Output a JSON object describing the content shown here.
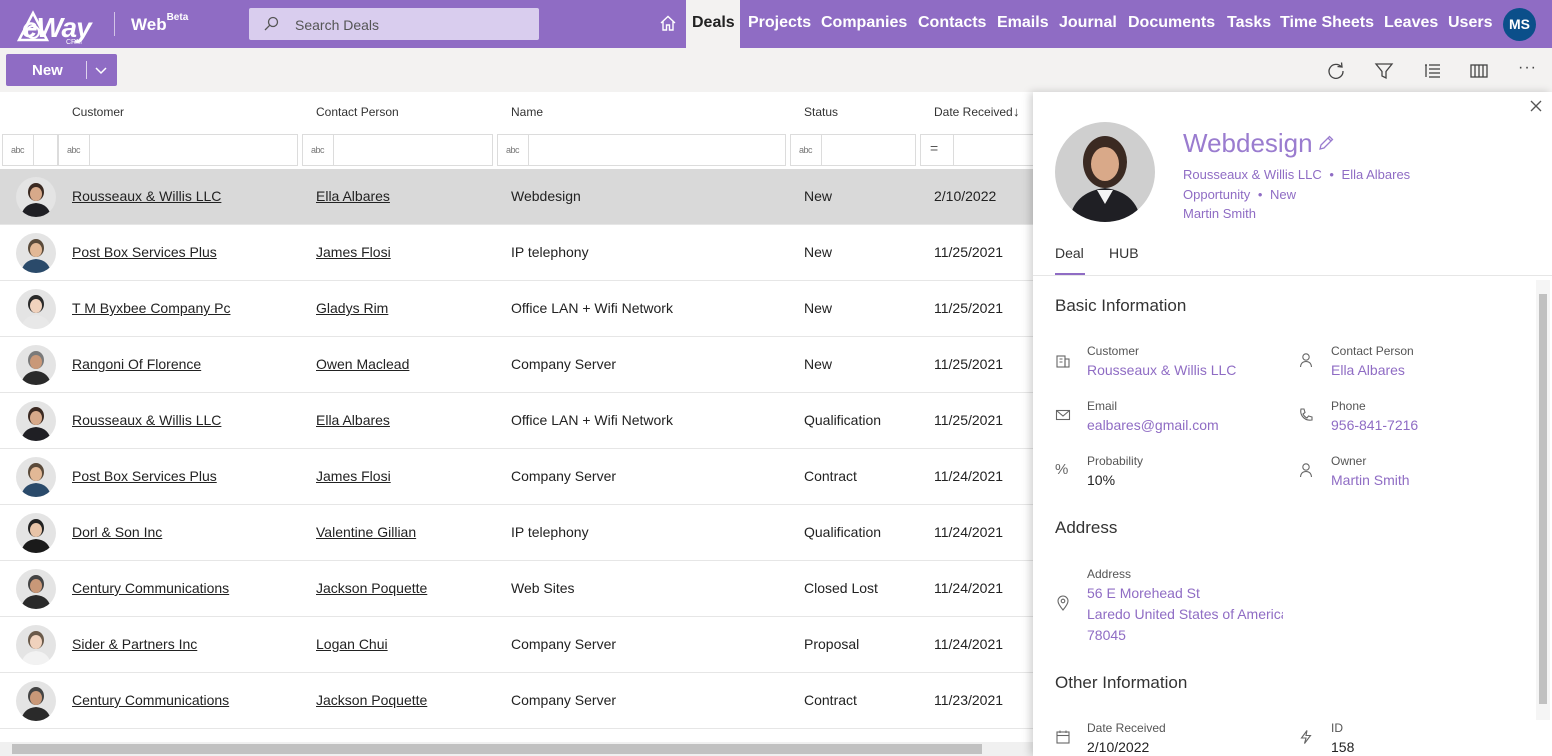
{
  "app": {
    "logo_text": "eWay",
    "logo_sub": "CRM",
    "web_label": "Web",
    "web_sup": "Beta",
    "search_placeholder": "Search Deals",
    "user_initials": "MS",
    "accent": "#8f6cc4"
  },
  "nav": {
    "items": [
      {
        "label": "Deals",
        "active": true
      },
      {
        "label": "Projects"
      },
      {
        "label": "Companies"
      },
      {
        "label": "Contacts"
      },
      {
        "label": "Emails"
      },
      {
        "label": "Journal"
      },
      {
        "label": "Documents"
      },
      {
        "label": "Tasks"
      },
      {
        "label": "Time Sheets"
      },
      {
        "label": "Leaves"
      },
      {
        "label": "Users"
      }
    ]
  },
  "toolbar": {
    "new_label": "New",
    "icons": [
      "refresh-icon",
      "filter-icon",
      "list-icon",
      "columns-icon",
      "more-icon"
    ],
    "more_glyph": "···"
  },
  "grid": {
    "columns": [
      "Customer",
      "Contact Person",
      "Name",
      "Status",
      "Date Received"
    ],
    "sort_arrow": "↓",
    "filter_badge": "abc",
    "filter_eq": "=",
    "rows": [
      {
        "customer": "Rousseaux & Willis LLC",
        "contact": "Ella Albares",
        "name": "Webdesign",
        "status": "New",
        "date": "2/10/2022",
        "selected": true
      },
      {
        "customer": "Post Box Services Plus",
        "contact": "James Flosi",
        "name": "IP telephony",
        "status": "New",
        "date": "11/25/2021"
      },
      {
        "customer": "T M Byxbee Company Pc",
        "contact": "Gladys Rim",
        "name": "Office LAN + Wifi Network",
        "status": "New",
        "date": "11/25/2021"
      },
      {
        "customer": "Rangoni Of Florence",
        "contact": "Owen Maclead",
        "name": "Company Server",
        "status": "New",
        "date": "11/25/2021"
      },
      {
        "customer": "Rousseaux & Willis LLC",
        "contact": "Ella Albares",
        "name": "Office LAN + Wifi Network",
        "status": "Qualification",
        "date": "11/25/2021"
      },
      {
        "customer": "Post Box Services Plus",
        "contact": "James Flosi",
        "name": "Company Server",
        "status": "Contract",
        "date": "11/24/2021"
      },
      {
        "customer": "Dorl & Son Inc",
        "contact": "Valentine Gillian",
        "name": "IP telephony",
        "status": "Qualification",
        "date": "11/24/2021"
      },
      {
        "customer": "Century Communications",
        "contact": "Jackson Poquette",
        "name": "Web Sites",
        "status": "Closed Lost",
        "date": "11/24/2021"
      },
      {
        "customer": "Sider & Partners Inc",
        "contact": "Logan Chui",
        "name": "Company Server",
        "status": "Proposal",
        "date": "11/24/2021"
      },
      {
        "customer": "Century Communications",
        "contact": "Jackson Poquette",
        "name": "Company Server",
        "status": "Contract",
        "date": "11/23/2021"
      }
    ]
  },
  "detail": {
    "title": "Webdesign",
    "company": "Rousseaux & Willis LLC",
    "bullet": "•",
    "contact": "Ella Albares",
    "type": "Opportunity",
    "status": "New",
    "owner": "Martin Smith",
    "tabs": [
      "Deal",
      "HUB"
    ],
    "sections": {
      "basic": "Basic Information",
      "address": "Address",
      "other": "Other Information"
    },
    "fields": {
      "customer_label": "Customer",
      "customer_value": "Rousseaux & Willis LLC",
      "contact_label": "Contact Person",
      "contact_value": "Ella Albares",
      "email_label": "Email",
      "email_value": "ealbares@gmail.com",
      "phone_label": "Phone",
      "phone_value": "956-841-7216",
      "probability_label": "Probability",
      "probability_value": "10%",
      "owner_label": "Owner",
      "owner_value": "Martin Smith",
      "address_label": "Address",
      "address_line1": "56 E Morehead St",
      "address_line2": "Laredo United States of America",
      "address_line3": "78045",
      "date_label": "Date Received",
      "date_value": "2/10/2022",
      "id_label": "ID",
      "id_value": "158"
    }
  }
}
